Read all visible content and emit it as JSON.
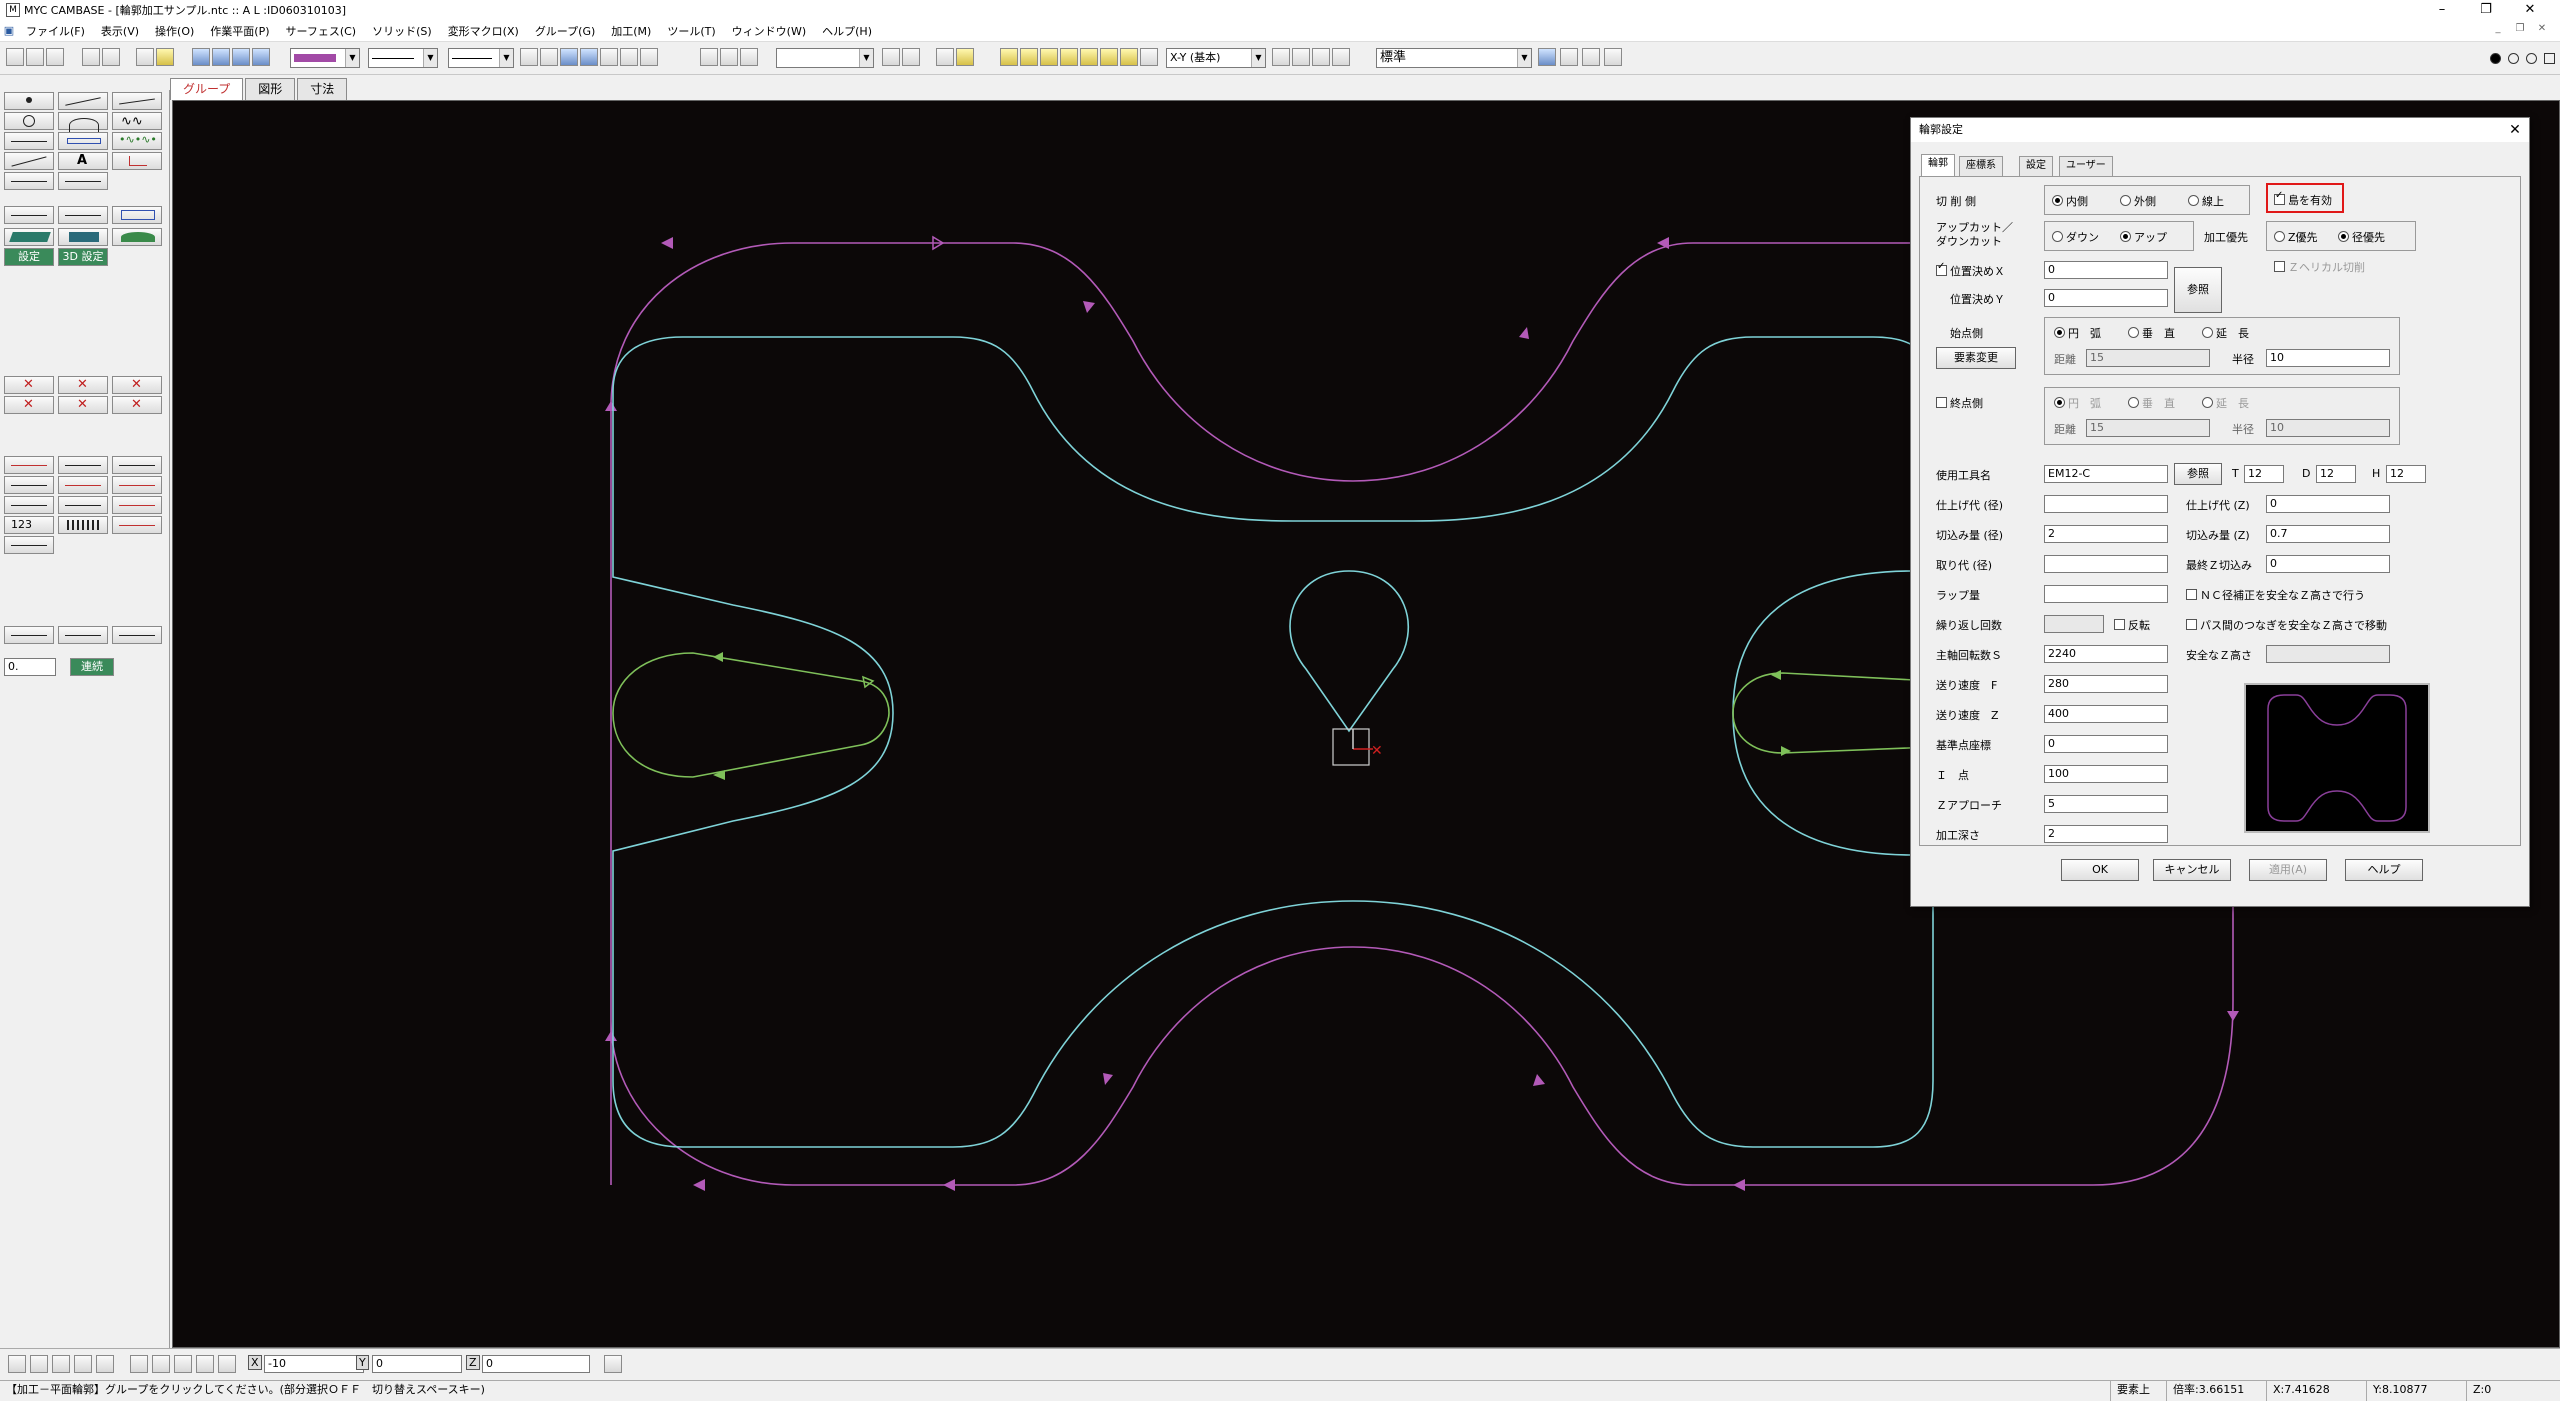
{
  "window": {
    "title": "MYC CAMBASE - [輪郭加工サンプル.ntc :: A L :ID060310103]",
    "minimize": "–",
    "restore": "❐",
    "close": "✕"
  },
  "menu": [
    "ファイル(F)",
    "表示(V)",
    "操作(O)",
    "作業平面(P)",
    "サーフェス(C)",
    "ソリッド(S)",
    "変形マクロ(X)",
    "グループ(G)",
    "加工(M)",
    "ツール(T)",
    "ウィンドウ(W)",
    "ヘルプ(H)"
  ],
  "toolbar": {
    "view_select": "X-Y (基本)",
    "style_select": "標準"
  },
  "tabs": [
    "グループ",
    "図形",
    "寸法"
  ],
  "left": {
    "settings": "設定",
    "settings3d": "3D 設定",
    "input_value": "0.",
    "continuous": "連続"
  },
  "dialog": {
    "title": "輪郭設定",
    "tabs": [
      "輪郭",
      "座標系",
      "設定",
      "ユーザー"
    ],
    "cut_side_label": "切 削 側",
    "cut_side_options": [
      "内側",
      "外側",
      "線上"
    ],
    "island_checkbox": "島を有効",
    "upcut_label": "アップカット／\nダウンカット",
    "upcut_options": [
      "ダウン",
      "アップ"
    ],
    "priority_label": "加工優先",
    "priority_options": [
      "Z優先",
      "径優先"
    ],
    "helical_checkbox": "Ｚヘリカル切削",
    "posx_checkbox": "位置決めＸ",
    "posx_value": "0",
    "posy_label": "位置決めＹ",
    "posy_value": "0",
    "ref_button": "参照",
    "start_label": "始点側",
    "element_change_button": "要素変更",
    "start_options": [
      "円　弧",
      "垂　直",
      "延　長"
    ],
    "distance_label": "距離",
    "start_distance": "15",
    "radius_label": "半径",
    "start_radius": "10",
    "end_checkbox": "終点側",
    "end_options": [
      "円　弧",
      "垂　直",
      "延　長"
    ],
    "end_distance": "15",
    "end_radius": "10",
    "tool_name_label": "使用工具名",
    "tool_name": "EM12-C",
    "tool_ref_button": "参照",
    "T_label": "T",
    "T_value": "12",
    "D_label": "D",
    "D_value": "12",
    "H_label": "H",
    "H_value": "12",
    "finish_allowance_label": "仕上げ代 (径)",
    "finish_allowance": "",
    "finish_z_label": "仕上げ代 (Z)",
    "finish_z": "0",
    "cut_amount_label": "切込み量 (径)",
    "cut_amount": "2",
    "cut_z_label": "切込み量 (Z)",
    "cut_z": "0.7",
    "stock_label": "取り代 (径)",
    "stock": "",
    "last_z_label": "最終Ｚ切込み",
    "last_z": "0",
    "lap_label": "ラップ量",
    "lap": "",
    "nc_checkbox": "ＮＣ径補正を安全なＺ高さで行う",
    "repeat_label": "繰り返し回数",
    "repeat": "",
    "reverse_checkbox": "反転",
    "path_checkbox": "パス間のつなぎを安全なＺ高さで移動",
    "spindle_label": "主軸回転数Ｓ",
    "spindle": "2240",
    "safe_z_label": "安全なＺ高さ",
    "safe_z": "",
    "feed_f_label": "送り速度　F",
    "feed_f": "280",
    "feed_z_label": "送り速度　Z",
    "feed_z": "400",
    "base_label": "基準点座標",
    "base": "0",
    "i_point_label": "Ｉ　点",
    "i_point": "100",
    "approach_label": "Ｚアプローチ",
    "approach": "5",
    "depth_label": "加工深さ",
    "depth": "2",
    "ok": "OK",
    "cancel": "キャンセル",
    "apply": "適用(A)",
    "help": "ヘルプ"
  },
  "coords_bar": {
    "x": "-10",
    "y": "0",
    "z": "0"
  },
  "status": {
    "message": "【加工－平面輪郭】グループをクリックしてください。(部分選択ＯＦＦ　切り替えスペースキー)",
    "element": "要素上",
    "scale": "倍率:3.66151",
    "x": "X:7.41628",
    "y": "Y:8.10877",
    "z": "Z:0"
  },
  "colors": {
    "cyan_path": "#7fd3d8",
    "magenta_path": "#b35ab8",
    "green_path": "#7fc05a",
    "highlight": "#e01818"
  }
}
